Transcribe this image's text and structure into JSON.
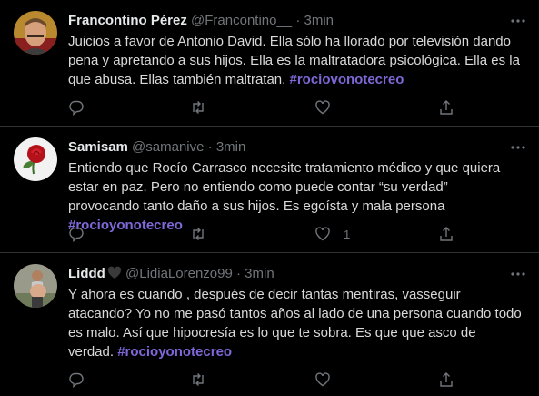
{
  "colors": {
    "background": "#000000",
    "text": "#d9d9d9",
    "muted": "#71767b",
    "hashtag": "#7e68d8",
    "divider": "#2f3336"
  },
  "tweets": [
    {
      "name": "Francontino Pérez",
      "handle": "@Francontino__",
      "separator": "·",
      "time": "3min",
      "text": "Juicios a favor de Antonio David. Ella sólo ha llorado por televisión dando pena y apretando a sus hijos. Ella es la maltratadora psicológica. Ella es la que abusa. Ellas también maltratan. ",
      "hashtag": "#rociovonotecreo",
      "like_count": "",
      "avatar_icon": "man-portrait-avatar"
    },
    {
      "name": "Samisam",
      "handle": "@samanive",
      "separator": "·",
      "time": "3min",
      "text": "Entiendo que Rocío Carrasco necesite tratamiento médico y que quiera estar en paz. Pero no entiendo como puede contar “su verdad” provocando tanto daño a sus hijos. Es egoísta y mala persona  ",
      "hashtag": "#rocioyonotecreo",
      "like_count": "1",
      "avatar_icon": "red-rose-avatar"
    },
    {
      "name": "Liddd",
      "name_emoji": "black-heart-icon",
      "handle": "@LidiaLorenzo99",
      "separator": "·",
      "time": "3min",
      "text": "Y ahora es cuando , después de decir tantas mentiras, vasseguir atacando? Yo no me pasó tantos años al lado de una persona cuando todo es malo. Así que hipocresía es lo que te sobra. Es que que asco de verdad. ",
      "hashtag": "#rocioyonotecreo",
      "like_count": "",
      "avatar_icon": "pregnant-woman-avatar"
    }
  ]
}
